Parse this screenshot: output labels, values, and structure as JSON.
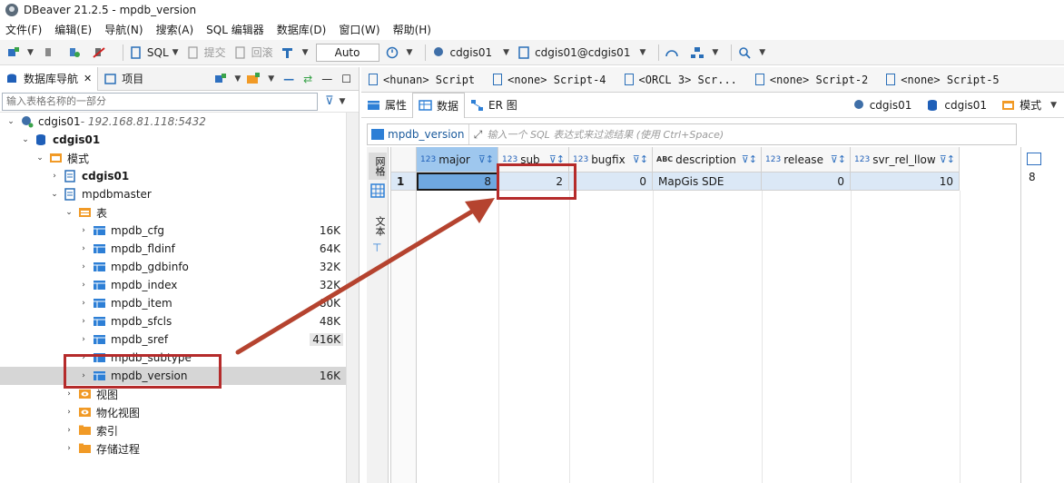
{
  "window": {
    "title": "DBeaver 21.2.5 - mpdb_version"
  },
  "menu": [
    "文件(F)",
    "编辑(E)",
    "导航(N)",
    "搜索(A)",
    "SQL 编辑器",
    "数据库(D)",
    "窗口(W)",
    "帮助(H)"
  ],
  "toolbar": {
    "sql": "SQL",
    "commit": "提交",
    "rollback": "回滚",
    "auto": "Auto",
    "datasource": "cdgis01",
    "schema": "cdgis01@cdgis01"
  },
  "left": {
    "tab_navigator": "数据库导航",
    "tab_projects": "项目",
    "filter_placeholder": "输入表格名称的一部分",
    "tree": {
      "conn_name": "cdgis01",
      "conn_host": " - 192.168.81.118:5432",
      "db": "cdgis01",
      "schemas_folder": "模式",
      "schema1": "cdgis01",
      "schema2": "mpdbmaster",
      "tables_folder": "表",
      "tables": [
        {
          "name": "mpdb_cfg",
          "size": "16K"
        },
        {
          "name": "mpdb_fldinf",
          "size": "64K"
        },
        {
          "name": "mpdb_gdbinfo",
          "size": "32K"
        },
        {
          "name": "mpdb_index",
          "size": "32K"
        },
        {
          "name": "mpdb_item",
          "size": "80K"
        },
        {
          "name": "mpdb_sfcls",
          "size": "48K"
        },
        {
          "name": "mpdb_sref",
          "size": "416K"
        },
        {
          "name": "mpdb_subtype",
          "size": ""
        },
        {
          "name": "mpdb_version",
          "size": "16K"
        }
      ],
      "views": "视图",
      "mat_views": "物化视图",
      "indexes": "索引",
      "procedures": "存储过程"
    }
  },
  "editor": {
    "tabs": [
      "<hunan> Script",
      "<none> Script-4",
      "<ORCL 3> Scr...",
      "<none> Script-2",
      "<none> Script-5"
    ],
    "sub_properties": "属性",
    "sub_data": "数据",
    "sub_er": "ER 图",
    "right_ds": "cdgis01",
    "right_db": "cdgis01",
    "right_schema": "模式",
    "filter_name": "mpdb_version",
    "filter_hint": "输入一个 SQL 表达式来过滤结果 (使用 Ctrl+Space)",
    "side_grid": "网格",
    "side_text": "文本",
    "columns": [
      {
        "type": "123",
        "name": "major"
      },
      {
        "type": "123",
        "name": "sub"
      },
      {
        "type": "123",
        "name": "bugfix"
      },
      {
        "type": "ABC",
        "name": "description"
      },
      {
        "type": "123",
        "name": "release"
      },
      {
        "type": "123",
        "name": "svr_rel_llow"
      }
    ],
    "row": {
      "num": "1",
      "major": "8",
      "sub": "2",
      "bugfix": "0",
      "description": "MapGis SDE",
      "release": "0",
      "svr_rel_llow": "10"
    },
    "right_value": "8"
  },
  "colors": {
    "accent": "#2d7fd6",
    "highlight": "#b52b2b",
    "selection": "#9ec7ee"
  }
}
